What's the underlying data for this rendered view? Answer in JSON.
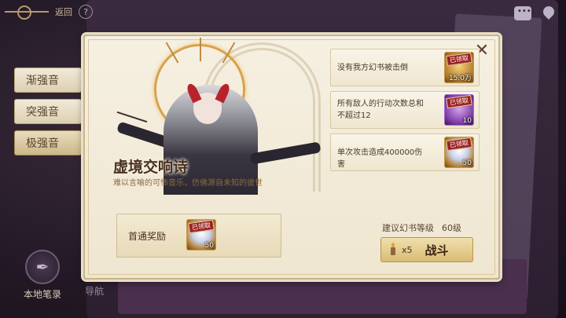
{
  "nav": {
    "back_label": "返回",
    "help_symbol": "?"
  },
  "side_tabs": [
    {
      "label": "渐强音",
      "active": false
    },
    {
      "label": "突强音",
      "active": false
    },
    {
      "label": "极强音",
      "active": true
    }
  ],
  "bottom_left": {
    "notebook_label": "本地笔录",
    "second_label": "导航"
  },
  "dialog": {
    "title": "虚境交响诗",
    "subtitle": "难以言喻的可怖音乐，仿佛源自未知的彼世",
    "close_symbol": "✕",
    "objectives": [
      {
        "text": "没有我方幻书被击倒",
        "reward_type": "gold",
        "claimed": "已领取",
        "count": "15.0万"
      },
      {
        "text": "所有敌人的行动次数总和不超过12",
        "reward_type": "purple",
        "claimed": "已领取",
        "count": "10"
      },
      {
        "text": "单次攻击造成400000伤害",
        "reward_type": "crystal",
        "claimed": "已领取",
        "count": "50"
      }
    ],
    "reward_section": {
      "label": "首通奖励",
      "claimed": "已领取",
      "count": "50"
    },
    "level": {
      "label": "建议幻书等级",
      "value": "60级"
    },
    "battle": {
      "cost": "x5",
      "label": "战斗"
    }
  }
}
